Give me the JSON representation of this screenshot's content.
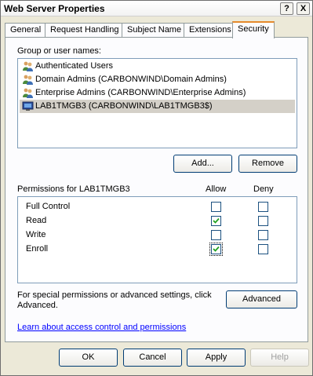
{
  "window": {
    "title": "Web Server Properties",
    "help_glyph": "?",
    "close_glyph": "X"
  },
  "tabs": [
    "General",
    "Request Handling",
    "Subject Name",
    "Extensions",
    "Security"
  ],
  "active_tab": "Security",
  "groups": {
    "label": "Group or user names:",
    "items": [
      {
        "name": "Authenticated Users",
        "icon": "user-group-icon",
        "selected": false
      },
      {
        "name": "Domain Admins (CARBONWIND\\Domain Admins)",
        "icon": "user-group-icon",
        "selected": false
      },
      {
        "name": "Enterprise Admins (CARBONWIND\\Enterprise Admins)",
        "icon": "user-group-icon",
        "selected": false
      },
      {
        "name": "LAB1TMGB3 (CARBONWIND\\LAB1TMGB3$)",
        "icon": "computer-icon",
        "selected": true
      }
    ],
    "add_label": "Add...",
    "remove_label": "Remove"
  },
  "permissions": {
    "label": "Permissions for LAB1TMGB3",
    "allow_header": "Allow",
    "deny_header": "Deny",
    "rows": [
      {
        "name": "Full Control",
        "allow": false,
        "deny": false
      },
      {
        "name": "Read",
        "allow": true,
        "deny": false
      },
      {
        "name": "Write",
        "allow": false,
        "deny": false
      },
      {
        "name": "Enroll",
        "allow": true,
        "deny": false
      }
    ]
  },
  "advanced": {
    "text": "For special permissions or advanced settings, click Advanced.",
    "button_label": "Advanced"
  },
  "learn_link": "Learn about access control and permissions",
  "footer": {
    "ok": "OK",
    "cancel": "Cancel",
    "apply": "Apply",
    "help": "Help"
  },
  "colors": {
    "selection": "#d4d0c8",
    "tab_highlight": "#e68b2c",
    "link": "#0000ff"
  }
}
